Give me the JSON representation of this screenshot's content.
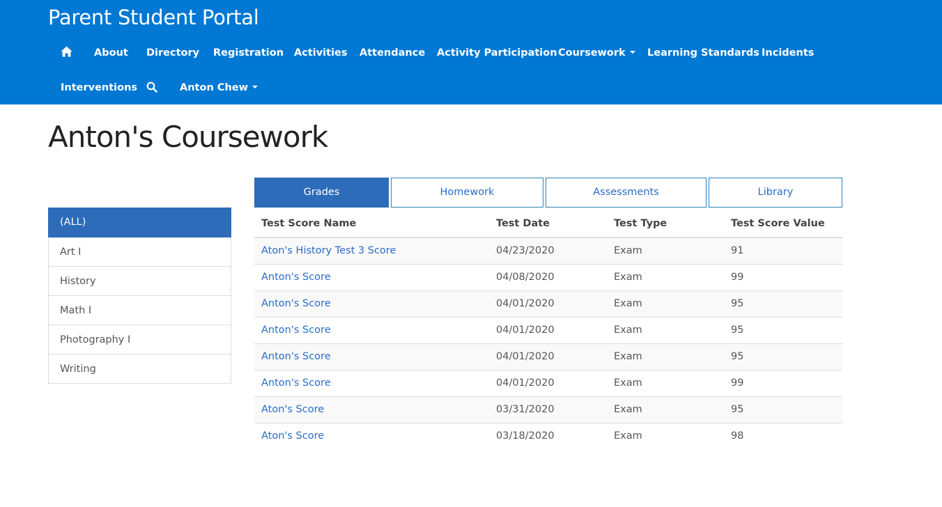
{
  "header": {
    "brand": "Parent Student Portal",
    "nav": {
      "home_icon": "home-icon",
      "about": "About",
      "directory": "Directory",
      "registration": "Registration",
      "activities": "Activities",
      "attendance": "Attendance",
      "activity_participation": "Activity Participation",
      "coursework": "Coursework",
      "learning_standards": "Learning Standards",
      "incidents": "Incidents",
      "interventions": "Interventions",
      "search_icon": "search-icon",
      "user": "Anton Chew"
    },
    "colors": {
      "background": "#0078d4",
      "text": "#ffffff"
    }
  },
  "page": {
    "title": "Anton's Coursework"
  },
  "sidebar": {
    "items": [
      {
        "label": "(ALL)",
        "active": true
      },
      {
        "label": "Art I"
      },
      {
        "label": "History"
      },
      {
        "label": "Math I"
      },
      {
        "label": "Photography I"
      },
      {
        "label": "Writing"
      }
    ]
  },
  "tabs": [
    {
      "label": "Grades",
      "active": true
    },
    {
      "label": "Homework"
    },
    {
      "label": "Assessments"
    },
    {
      "label": "Library"
    }
  ],
  "table": {
    "headers": [
      "Test Score Name",
      "Test Date",
      "Test Type",
      "Test Score Value"
    ],
    "rows": [
      [
        "Aton's History Test 3 Score",
        "04/23/2020",
        "Exam",
        "91"
      ],
      [
        "Anton's Score",
        "04/08/2020",
        "Exam",
        "99"
      ],
      [
        "Anton's Score",
        "04/01/2020",
        "Exam",
        "95"
      ],
      [
        "Anton's Score",
        "04/01/2020",
        "Exam",
        "95"
      ],
      [
        "Anton's Score",
        "04/01/2020",
        "Exam",
        "95"
      ],
      [
        "Anton's Score",
        "04/01/2020",
        "Exam",
        "99"
      ],
      [
        "Aton's Score",
        "03/31/2020",
        "Exam",
        "95"
      ],
      [
        "Aton's Score",
        "03/18/2020",
        "Exam",
        "98"
      ]
    ]
  },
  "colors": {
    "accent": "#2c6cb8",
    "link": "#2a6dc7"
  }
}
